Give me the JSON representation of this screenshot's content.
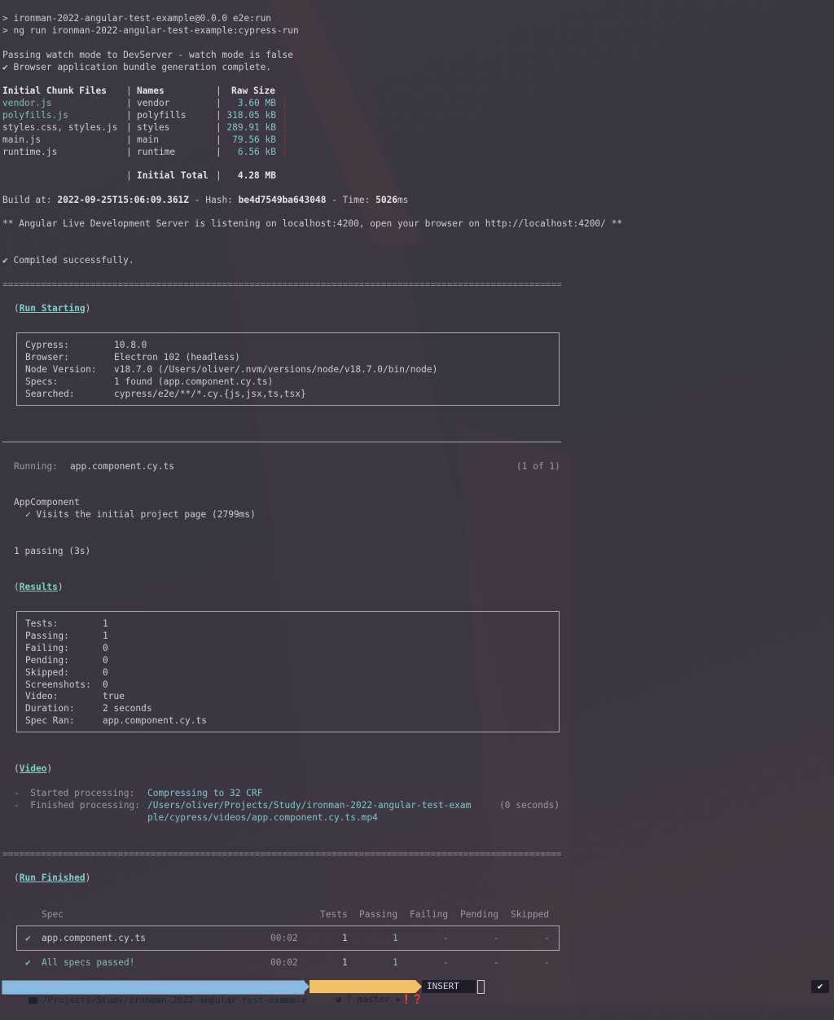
{
  "cmd": {
    "line1": "> ironman-2022-angular-test-example@0.0.0 e2e:run",
    "line2": "> ng run ironman-2022-angular-test-example:cypress-run"
  },
  "devserver": {
    "line1": "Passing watch mode to DevServer - watch mode is false",
    "line2": "✔ Browser application bundle generation complete."
  },
  "chunks": {
    "headers": [
      "Initial Chunk Files",
      "Names",
      "Raw Size"
    ],
    "rows": [
      {
        "file": "vendor.js",
        "name": "vendor",
        "size": "3.60 MB"
      },
      {
        "file": "polyfills.js",
        "name": "polyfills",
        "size": "318.05 kB"
      },
      {
        "file": "styles.css, styles.js",
        "name": "styles",
        "size": "289.91 kB"
      },
      {
        "file": "main.js",
        "name": "main",
        "size": "79.56 kB"
      },
      {
        "file": "runtime.js",
        "name": "runtime",
        "size": "6.56 kB"
      }
    ],
    "total_label": "Initial Total",
    "total_value": "4.28 MB"
  },
  "build": {
    "at_label": "Build at:",
    "at_value": "2022-09-25T15:06:09.361Z",
    "hash_label": " - Hash:",
    "hash_value": "be4d7549ba643048",
    "time_label": " - Time:",
    "time_value": "5026",
    "time_unit": "ms"
  },
  "server_msg": "** Angular Live Development Server is listening on localhost:4200, open your browser on http://localhost:4200/ **",
  "compiled": "✔ Compiled successfully.",
  "separator": "======================================================================================================",
  "run_starting": {
    "open": "(",
    "title": "Run Starting",
    "close": ")",
    "rows": [
      {
        "k": "Cypress:",
        "v": "10.8.0"
      },
      {
        "k": "Browser:",
        "v": "Electron 102 (headless)"
      },
      {
        "k": "Node Version:",
        "v": "v18.7.0 (/Users/oliver/.nvm/versions/node/v18.7.0/bin/node)"
      },
      {
        "k": "Specs:",
        "v": "1 found (app.component.cy.ts)"
      },
      {
        "k": "Searched:",
        "v": "cypress/e2e/**/*.cy.{js,jsx,ts,tsx}"
      }
    ]
  },
  "running": {
    "label": "Running:",
    "spec": "app.component.cy.ts",
    "count": "(1 of 1)"
  },
  "suite": {
    "name": "AppComponent",
    "test": "✓ Visits the initial project page (2799ms)",
    "passing": "1 passing (3s)"
  },
  "results": {
    "title": "Results",
    "rows": [
      {
        "k": "Tests:",
        "v": "1"
      },
      {
        "k": "Passing:",
        "v": "1"
      },
      {
        "k": "Failing:",
        "v": "0"
      },
      {
        "k": "Pending:",
        "v": "0"
      },
      {
        "k": "Skipped:",
        "v": "0"
      },
      {
        "k": "Screenshots:",
        "v": "0"
      },
      {
        "k": "Video:",
        "v": "true"
      },
      {
        "k": "Duration:",
        "v": "2 seconds"
      },
      {
        "k": "Spec Ran:",
        "v": "app.component.cy.ts"
      }
    ]
  },
  "video": {
    "title": "Video",
    "started_label": "-  Started processing:",
    "started_value": "Compressing to 32 CRF",
    "finished_label": "-  Finished processing:",
    "finished_value1": "/Users/oliver/Projects/Study/ironman-2022-angular-test-exam",
    "finished_value2": "ple/cypress/videos/app.component.cy.ts.mp4",
    "finished_time": "(0 seconds)"
  },
  "run_finished": {
    "title": "Run Finished",
    "headers": {
      "spec": "Spec",
      "tests": "Tests",
      "passing": "Passing",
      "failing": "Failing",
      "pending": "Pending",
      "skipped": "Skipped"
    },
    "row": {
      "mark": "✔",
      "spec": "app.component.cy.ts",
      "time": "00:02",
      "tests": "1",
      "passing": "1",
      "failing": "-",
      "pending": "-",
      "skipped": "-"
    },
    "summary": {
      "mark": "✔",
      "label": "All specs passed!",
      "time": "00:02",
      "tests": "1",
      "passing": "1",
      "failing": "-",
      "pending": "-",
      "skipped": "-"
    }
  },
  "statusbar": {
    "path": "~/Projects/Study/ironman-2022-angular-test-example",
    "branch": "master",
    "git_flags": "✚❗❓",
    "mode": "INSERT",
    "right_check": "✔"
  },
  "colors": {
    "path_bg": "#89b8e0",
    "git_bg": "#f3c064",
    "mode_bg": "#1e1d29",
    "accent_green": "#7fc3a8",
    "accent_cyan": "#7cc7cf"
  }
}
